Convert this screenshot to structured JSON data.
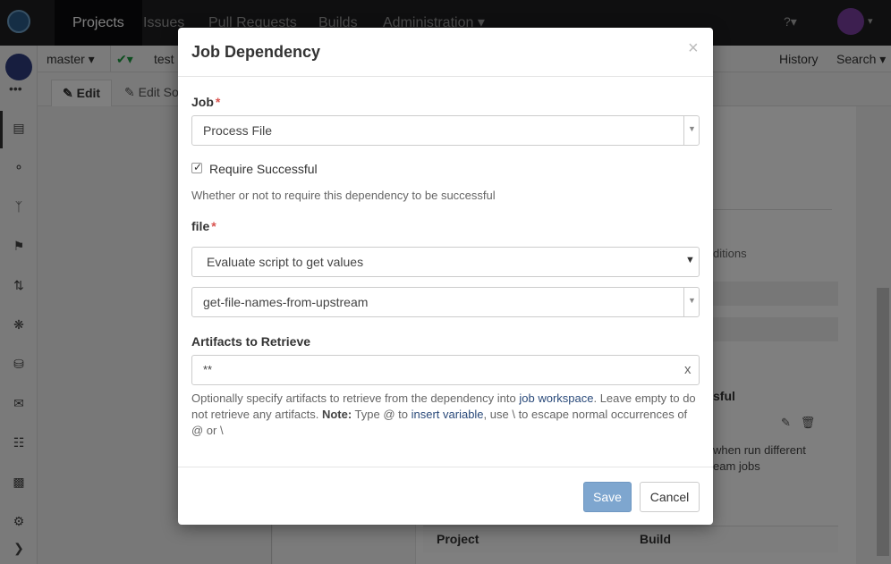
{
  "topnav": {
    "items": [
      "Projects",
      "Issues",
      "Pull Requests",
      "Builds",
      "Administration"
    ],
    "help_icon": "question-circle-icon"
  },
  "toolbar": {
    "branch": "master",
    "build_name": "test",
    "history": "History",
    "search": "Search"
  },
  "tabs": {
    "edit": "Edit",
    "edit_source": "Edit Sou"
  },
  "background": {
    "conditions_fragment": "ditions",
    "successful_fragment": "sful",
    "desc_line1": "when run different",
    "desc_line2": "eam jobs",
    "table_headers": [
      "Project",
      "Build"
    ]
  },
  "modal": {
    "title": "Job Dependency",
    "close": "×",
    "job_label": "Job",
    "job_value": "Process File",
    "require_successful_label": "Require Successful",
    "require_successful_checked": true,
    "require_successful_help": "Whether or not to require this dependency to be successful",
    "file_label": "file",
    "file_mode_value": "Evaluate script to get values",
    "file_script_value": "get-file-names-from-upstream",
    "artifacts_label": "Artifacts to Retrieve",
    "artifacts_value": "**",
    "artifacts_clear": "x",
    "artifacts_help": {
      "part1": "Optionally specify artifacts to retrieve from the dependency into ",
      "link1": "job workspace",
      "part2": ". Leave empty to do not retrieve any artifacts. ",
      "note_label": "Note:",
      "part3": " Type @ to ",
      "link2": "insert variable",
      "part4": ", use \\ to escape normal occurrences of @ or \\"
    },
    "save": "Save",
    "cancel": "Cancel"
  },
  "colors": {
    "required": "#d9534f",
    "primary_button": "#7ea6cf",
    "link": "#2a4a7a",
    "topnav_bg": "#1f1f21"
  }
}
